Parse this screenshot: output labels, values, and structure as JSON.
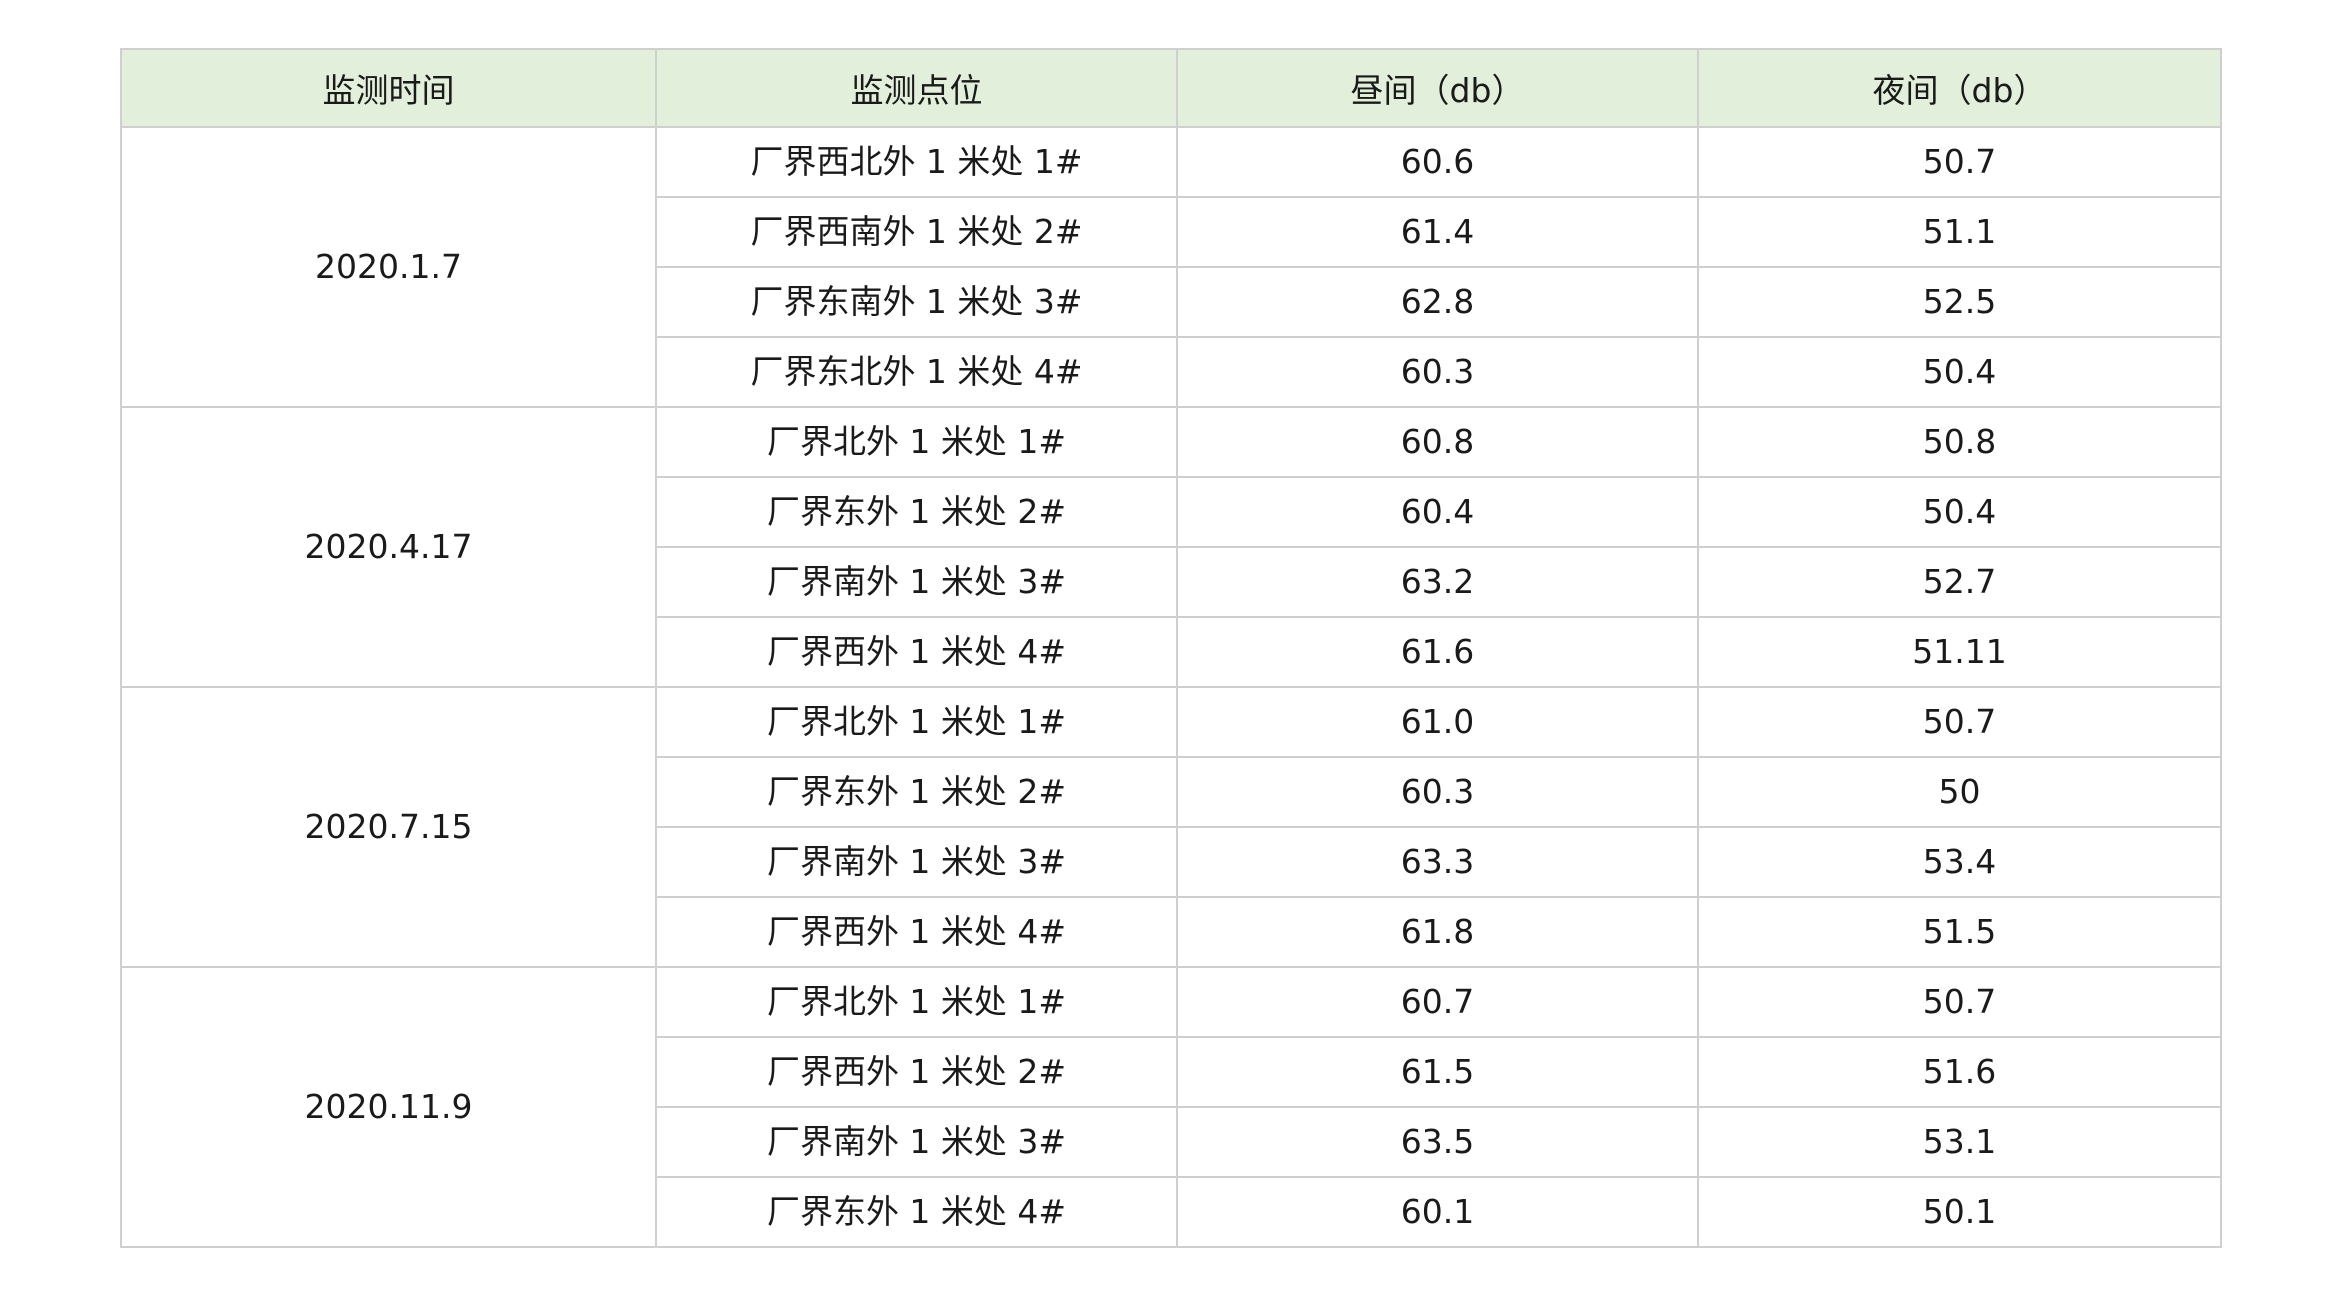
{
  "table": {
    "headers": [
      "监测时间",
      "监测点位",
      "昼间（db）",
      "夜间（db）"
    ],
    "groups": [
      {
        "date": "2020.1.7",
        "rows": [
          {
            "point": "厂界西北外 1 米处 1#",
            "day": "60.6",
            "night": "50.7"
          },
          {
            "point": "厂界西南外 1 米处 2#",
            "day": "61.4",
            "night": "51.1"
          },
          {
            "point": "厂界东南外 1 米处 3#",
            "day": "62.8",
            "night": "52.5"
          },
          {
            "point": "厂界东北外 1 米处 4#",
            "day": "60.3",
            "night": "50.4"
          }
        ]
      },
      {
        "date": "2020.4.17",
        "rows": [
          {
            "point": "厂界北外 1 米处 1#",
            "day": "60.8",
            "night": "50.8"
          },
          {
            "point": "厂界东外 1 米处 2#",
            "day": "60.4",
            "night": "50.4"
          },
          {
            "point": "厂界南外 1 米处 3#",
            "day": "63.2",
            "night": "52.7"
          },
          {
            "point": "厂界西外 1 米处 4#",
            "day": "61.6",
            "night": "51.11"
          }
        ]
      },
      {
        "date": "2020.7.15",
        "rows": [
          {
            "point": "厂界北外 1 米处 1#",
            "day": "61.0",
            "night": "50.7"
          },
          {
            "point": "厂界东外 1 米处 2#",
            "day": "60.3",
            "night": "50"
          },
          {
            "point": "厂界南外 1 米处 3#",
            "day": "63.3",
            "night": "53.4"
          },
          {
            "point": "厂界西外 1 米处 4#",
            "day": "61.8",
            "night": "51.5"
          }
        ]
      },
      {
        "date": "2020.11.9",
        "rows": [
          {
            "point": "厂界北外 1 米处 1#",
            "day": "60.7",
            "night": "50.7"
          },
          {
            "point": "厂界西外 1 米处 2#",
            "day": "61.5",
            "night": "51.6"
          },
          {
            "point": "厂界南外 1 米处 3#",
            "day": "63.5",
            "night": "53.1"
          },
          {
            "point": "厂界东外 1 米处 4#",
            "day": "60.1",
            "night": "50.1"
          }
        ]
      }
    ]
  },
  "colors": {
    "header_bg": "#e2efda",
    "border": "#cfcfcf",
    "text": "#1a1a1a"
  }
}
